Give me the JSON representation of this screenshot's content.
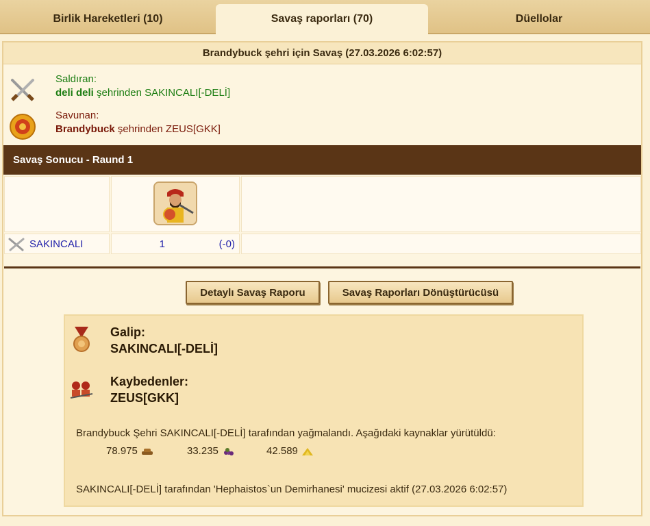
{
  "tabs": [
    {
      "label": "Birlik Hareketleri (10)"
    },
    {
      "label": "Savaş raporları (70)"
    },
    {
      "label": "Düellolar"
    }
  ],
  "report": {
    "title": "Brandybuck şehri için Savaş (27.03.2026 6:02:57)",
    "attacker": {
      "role": "Saldıran:",
      "city": "deli deli",
      "connector": " şehrinden ",
      "player": "SAKINCALI[-DELİ]"
    },
    "defender": {
      "role": "Savunan:",
      "city": "Brandybuck",
      "connector": " şehrinden ",
      "player": "ZEUS[GKK]"
    }
  },
  "result_table": {
    "header": "Savaş Sonucu - Raund 1",
    "row": {
      "name": "SAKINCALI",
      "count": "1",
      "losses": "(-0)"
    }
  },
  "buttons": {
    "detailed_report": "Detaylı Savaş Raporu",
    "converter": "Savaş Raporları Dönüştürücüsü"
  },
  "summary": {
    "winner_label": "Galip:",
    "winner": "SAKINCALI[-DELİ]",
    "losers_label": "Kaybedenler:",
    "losers": "ZEUS[GKK]",
    "plunder_text": "Brandybuck Şehri SAKINCALI[-DELİ] tarafından yağmalandı. Aşağıdaki kaynaklar yürütüldü:",
    "resources": [
      {
        "amount": "78.975",
        "icon": "wood-icon"
      },
      {
        "amount": "33.235",
        "icon": "wine-icon"
      },
      {
        "amount": "42.589",
        "icon": "sulfur-icon"
      }
    ],
    "wonder_text": "SAKINCALI[-DELİ] tarafından 'Hephaistos`un Demirhanesi' mucizesi aktif (27.03.2026 6:02:57)"
  },
  "colors": {
    "attacker_green": "#1c7d12",
    "defender_red": "#7a1a0a",
    "header_brown": "#5a3516",
    "link_blue": "#2222aa"
  }
}
